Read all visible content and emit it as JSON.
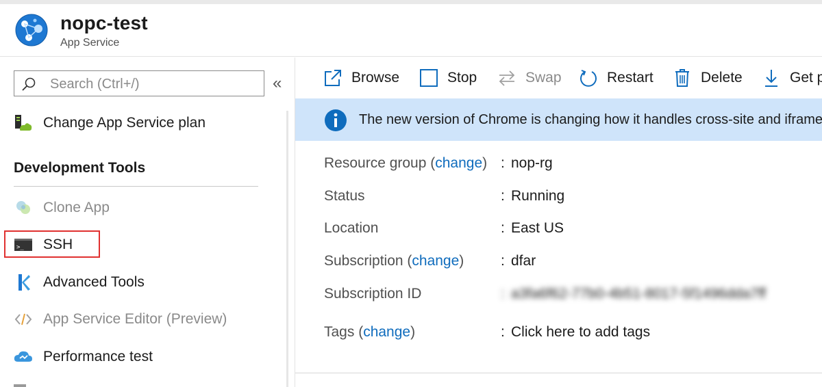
{
  "header": {
    "title": "nopc-test",
    "subtitle": "App Service",
    "logo_icon": "app-service-icon"
  },
  "sidebar": {
    "search": {
      "placeholder": "Search (Ctrl+/)"
    },
    "collapse_glyph": "«",
    "top_item": {
      "label": "Change App Service plan",
      "icon": "app-service-plan-icon"
    },
    "section_title": "Development Tools",
    "items": [
      {
        "label": "Clone App",
        "icon": "clone-app-icon",
        "disabled": true
      },
      {
        "label": "SSH",
        "icon": "console-icon",
        "highlighted": true
      },
      {
        "label": "Advanced Tools",
        "icon": "kudu-icon"
      },
      {
        "label": "App Service Editor (Preview)",
        "icon": "code-icon",
        "disabled": true
      },
      {
        "label": "Performance test",
        "icon": "cloud-icon"
      }
    ]
  },
  "toolbar": {
    "browse": "Browse",
    "stop": "Stop",
    "swap": "Swap",
    "restart": "Restart",
    "delete": "Delete",
    "get_publish": "Get p"
  },
  "banner": {
    "message": "The new version of Chrome is changing how it handles cross-site and iframe"
  },
  "essentials": {
    "resource_group": {
      "label": "Resource group",
      "change": "change",
      "value": "nop-rg"
    },
    "status": {
      "label": "Status",
      "value": "Running"
    },
    "location": {
      "label": "Location",
      "value": "East US"
    },
    "subscription": {
      "label": "Subscription",
      "change": "change",
      "value": "dfar"
    },
    "subscription_id": {
      "label": "Subscription ID",
      "value": "a3fa6f62-77b0-4b51-8017-5f1496dda7ff"
    },
    "tags": {
      "label": "Tags",
      "change": "change",
      "value": "Click here to add tags"
    }
  },
  "colors": {
    "accent": "#0f6cbd",
    "banner_bg": "#cfe4fa",
    "highlight_border": "#e0302f"
  }
}
